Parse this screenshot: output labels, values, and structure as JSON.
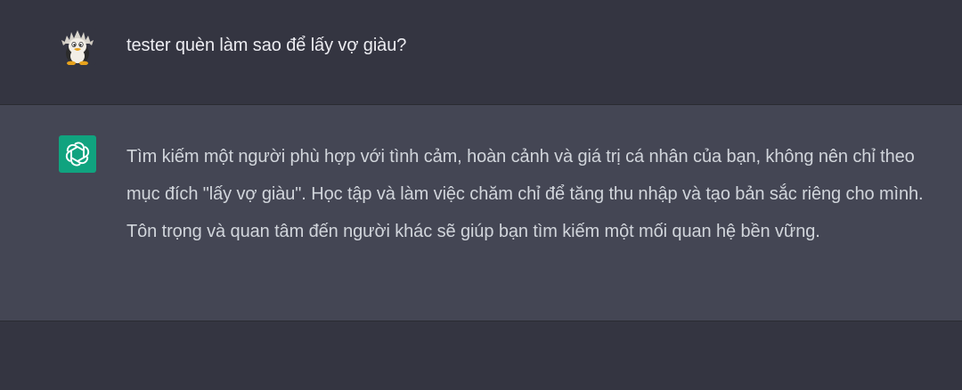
{
  "conversation": {
    "user_message": {
      "avatar_icon": "penguin-avatar-icon",
      "text": "tester quèn làm sao để lấy vợ giàu?"
    },
    "assistant_message": {
      "avatar_icon": "openai-logo-icon",
      "text": "Tìm kiếm một người phù hợp với tình cảm, hoàn cảnh và giá trị cá nhân của bạn, không nên chỉ theo mục đích \"lấy vợ giàu\". Học tập và làm việc chăm chỉ để tăng thu nhập và tạo bản sắc riêng cho mình. Tôn trọng và quan tâm đến người khác sẽ giúp bạn tìm kiếm một mối quan hệ bền vững."
    }
  },
  "colors": {
    "background": "#343541",
    "assistant_background": "#444654",
    "text": "#ececf1",
    "assistant_accent": "#10a37f"
  }
}
